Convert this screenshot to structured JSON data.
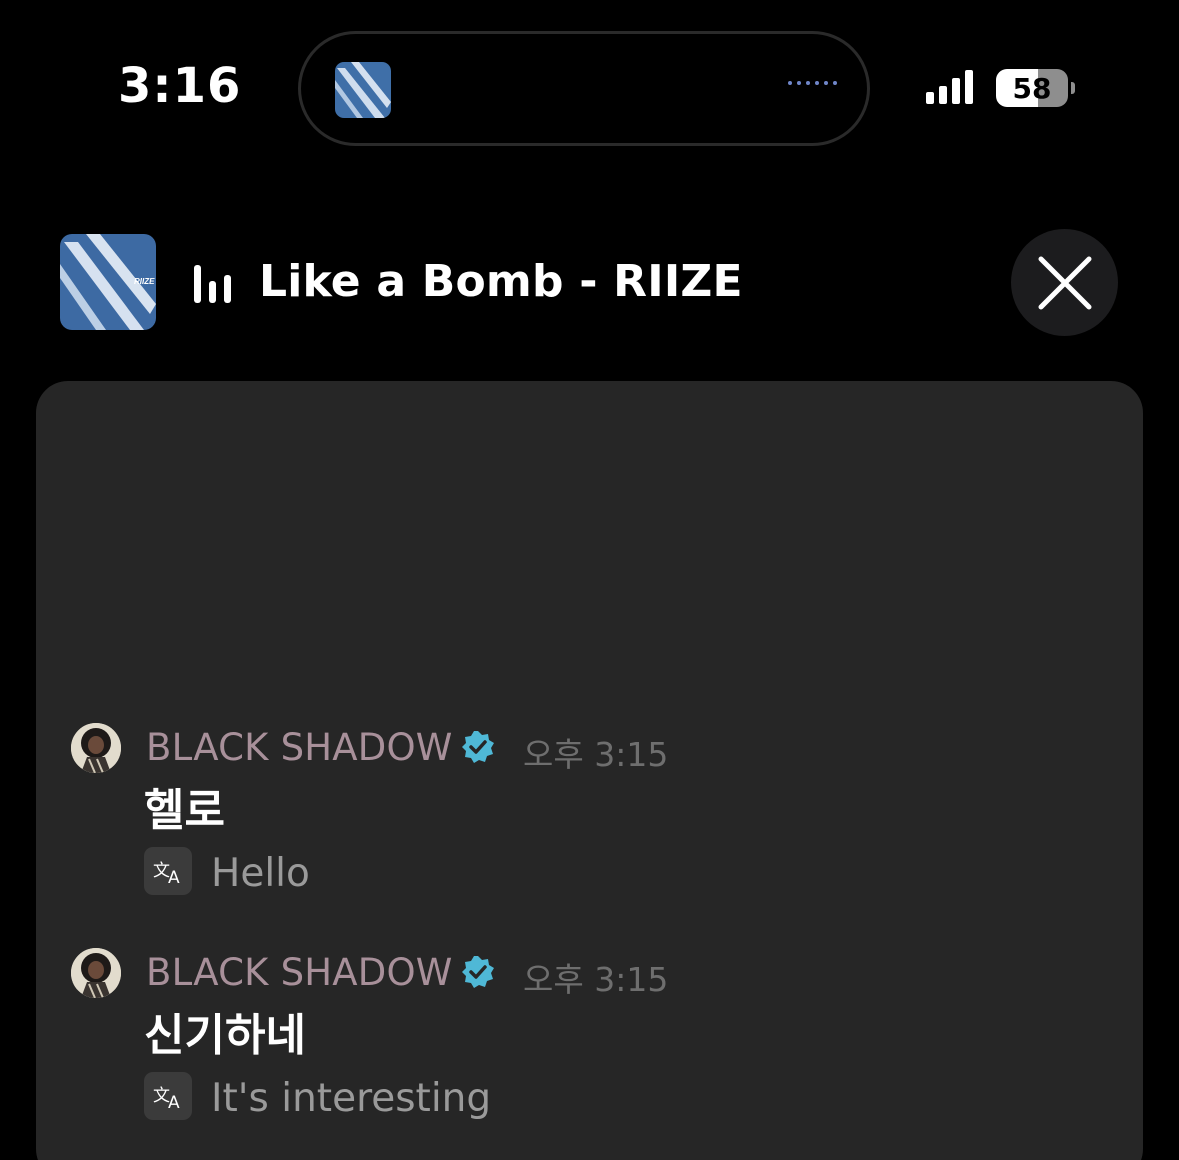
{
  "status_bar": {
    "time": "3:16",
    "battery": "58"
  },
  "now_playing": {
    "title": "Like a Bomb - RIIZE",
    "album_label": "RIIZE"
  },
  "chat": {
    "messages": [
      {
        "user": "BLACK SHADOW",
        "verified": true,
        "time": "오후 3:15",
        "text": "헬로",
        "translation": "Hello"
      },
      {
        "user": "BLACK SHADOW",
        "verified": true,
        "time": "오후 3:15",
        "text": "신기하네",
        "translation": "It's interesting"
      }
    ]
  },
  "icons": {
    "close": "close-icon",
    "translate": "translate-icon",
    "verified": "verified-badge-icon",
    "equalizer": "equalizer-icon"
  },
  "colors": {
    "background": "#000000",
    "panel": "#262626",
    "username": "#a8909a",
    "verified": "#4fb8d6",
    "timestamp": "#6e6e6e"
  }
}
